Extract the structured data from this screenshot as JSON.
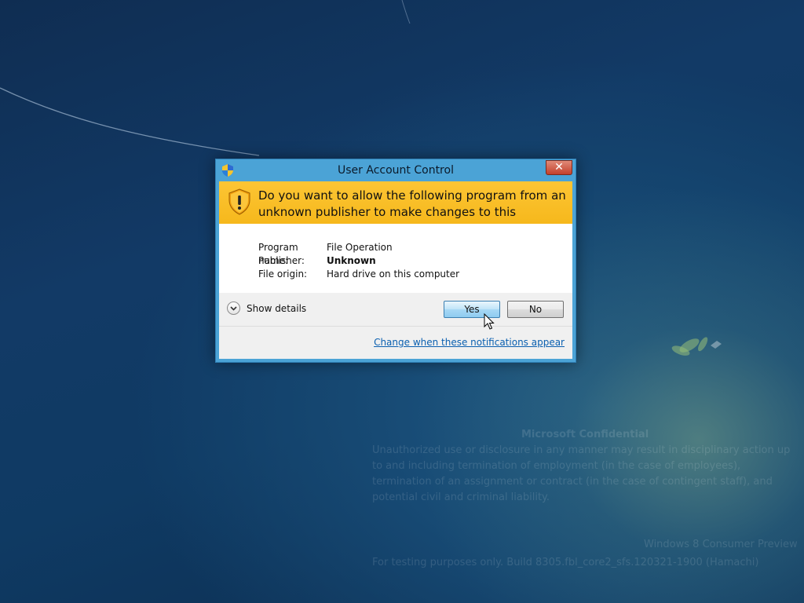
{
  "window": {
    "title": "User Account Control",
    "close_label": "✕"
  },
  "banner": {
    "question": "Do you want to allow the following program from an unknown publisher to make changes to this computer?"
  },
  "info": {
    "program_name_label": "Program name:",
    "program_name_value": "File Operation",
    "publisher_label": "Publisher:",
    "publisher_value": "Unknown",
    "file_origin_label": "File origin:",
    "file_origin_value": "Hard drive on this computer"
  },
  "actions": {
    "show_details_label": "Show details",
    "yes_label": "Yes",
    "no_label": "No",
    "change_link": "Change when these notifications appear"
  },
  "watermark": {
    "title": "Microsoft Confidential",
    "body_lines": [
      "Unauthorized use or disclosure in any manner may result in disciplinary action up",
      "to and including termination of employment (in the case of employees),",
      "termination of an assignment or contract (in the case of contingent staff), and",
      "potential civil and criminal liability."
    ],
    "build_edition": "Windows 8 Consumer Preview",
    "testing_note": "For testing purposes only. Build 8305.fbl_core2_sfs.120321-1900 (Hamachi)"
  },
  "colors": {
    "banner": "#fcc534",
    "window_frame": "#4ba3d6",
    "link": "#0a5fb0"
  }
}
